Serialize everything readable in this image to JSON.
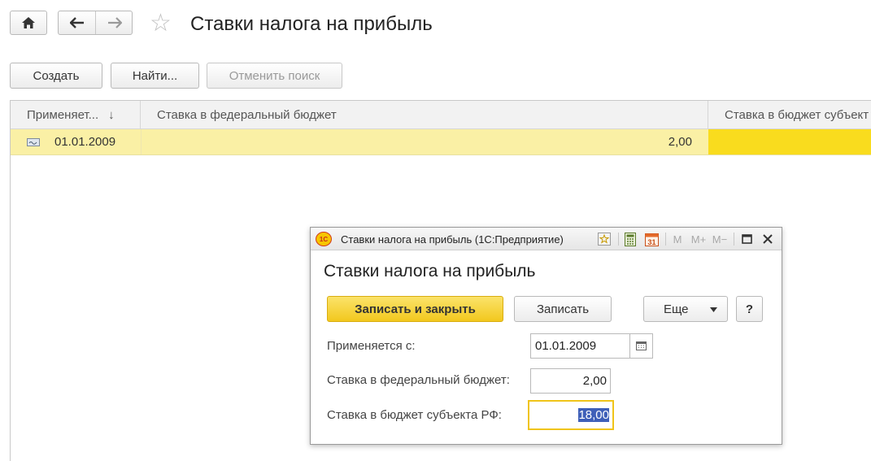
{
  "page": {
    "title": "Ставки налога на прибыль",
    "nav": {
      "home_icon": "home-icon",
      "back_icon": "arrow-left-icon",
      "forward_icon": "arrow-right-icon",
      "favorite_icon": "star-icon"
    }
  },
  "toolbar": {
    "create_label": "Создать",
    "find_label": "Найти...",
    "cancel_search_label": "Отменить поиск"
  },
  "table": {
    "columns": [
      "Применяет...",
      "Ставка в федеральный бюджет",
      "Ставка в бюджет субъект"
    ],
    "sort_indicator": "↓",
    "rows": [
      {
        "date": "01.01.2009",
        "federal_rate": "2,00",
        "regional_rate": ""
      }
    ]
  },
  "dialog": {
    "window_title": "Ставки налога на прибыль  (1С:Предприятие)",
    "app_logo": "1С",
    "bar_icons": [
      "star-icon",
      "calculator-icon",
      "calendar-icon"
    ],
    "memory_labels": [
      "M",
      "M+",
      "M−"
    ],
    "heading": "Ставки налога на прибыль",
    "save_close_label": "Записать и закрыть",
    "save_label": "Записать",
    "more_label": "Еще",
    "help_label": "?",
    "fields": {
      "applies_from_label": "Применяется с:",
      "applies_from_value": "01.01.2009",
      "federal_label": "Ставка в федеральный бюджет:",
      "federal_value": "2,00",
      "regional_label": "Ставка в бюджет субъекта РФ:",
      "regional_value": "18,00"
    }
  },
  "colors": {
    "row_highlight": "#faf0a5",
    "selected_cell": "#f9dc1e",
    "primary_button": "#f5d330",
    "focus_border": "#f0c419",
    "text_selection": "#3f5fb8"
  }
}
